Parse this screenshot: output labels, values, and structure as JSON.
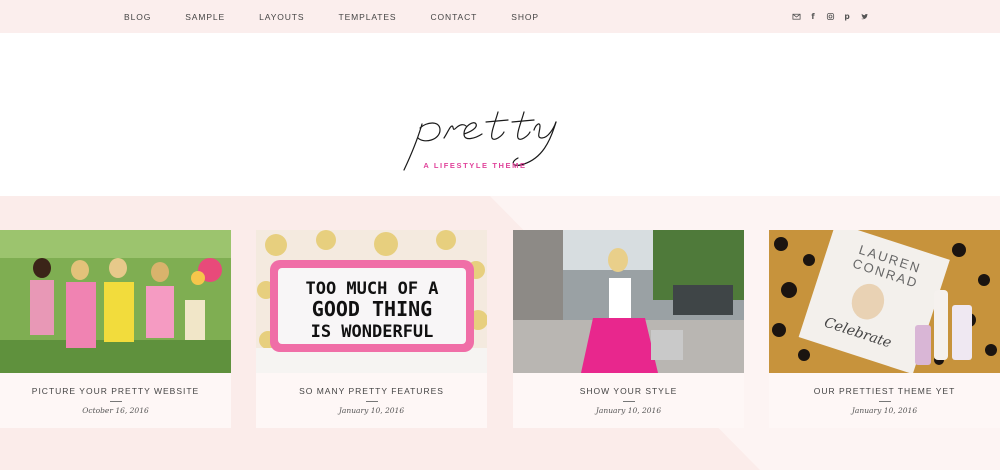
{
  "nav": {
    "items": [
      "BLOG",
      "SAMPLE",
      "LAYOUTS",
      "TEMPLATES",
      "CONTACT",
      "SHOP"
    ]
  },
  "social": {
    "icons": [
      "email-icon",
      "facebook-icon",
      "instagram-icon",
      "pinterest-icon",
      "twitter-icon"
    ],
    "facebook_glyph": "f",
    "pinterest_glyph": "p"
  },
  "header": {
    "logo_text": "pretty",
    "tagline": "A LIFESTYLE THEME"
  },
  "posts": [
    {
      "title": "PICTURE YOUR PRETTY WEBSITE",
      "date": "October 16, 2016"
    },
    {
      "title": "SO MANY PRETTY FEATURES",
      "date": "January 10, 2016"
    },
    {
      "title": "SHOW YOUR STYLE",
      "date": "January 10, 2016"
    },
    {
      "title": "OUR PRETTIEST THEME YET",
      "date": "January 10, 2016"
    }
  ],
  "pillow": {
    "line1": "TOO MUCH OF A",
    "line2": "GOOD THING",
    "line3": "IS WONDERFUL"
  },
  "magazine": {
    "name1": "LAUREN",
    "name2": "CONRAD",
    "script": "Celebrate"
  },
  "colors": {
    "topbar": "#fbeeed",
    "accent_pink": "#e0449b",
    "content_bg": "#fcf1f0",
    "card_meta_bg": "#fef7f6"
  }
}
